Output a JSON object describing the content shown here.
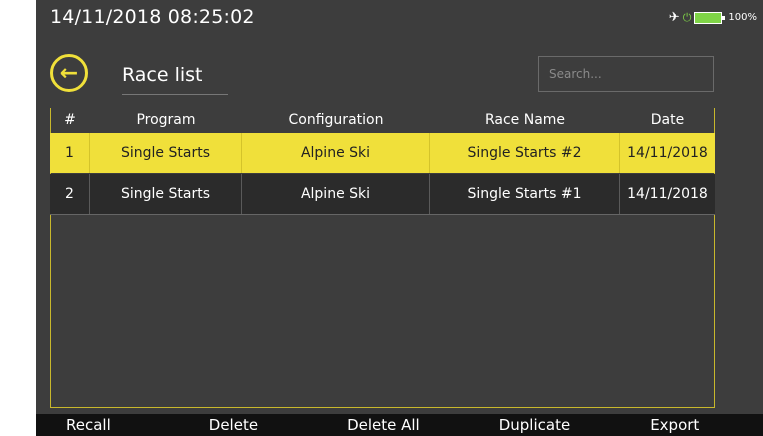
{
  "status": {
    "datetime": "14/11/2018  08:25:02",
    "battery": "100%"
  },
  "header": {
    "title": "Race list",
    "search_placeholder": "Search..."
  },
  "table": {
    "columns": [
      "#",
      "Program",
      "Configuration",
      "Race Name",
      "Date"
    ],
    "rows": [
      {
        "num": "1",
        "program": "Single Starts",
        "configuration": "Alpine Ski",
        "race_name": "Single Starts #2",
        "date": "14/11/2018"
      },
      {
        "num": "2",
        "program": "Single Starts",
        "configuration": "Alpine Ski",
        "race_name": "Single Starts #1",
        "date": "14/11/2018"
      }
    ]
  },
  "actions": [
    "Recall",
    "Delete",
    "Delete All",
    "Duplicate",
    "Export"
  ],
  "colors": {
    "accent": "#f0e03a",
    "background": "#3d3d3d",
    "bar": "#111111"
  }
}
